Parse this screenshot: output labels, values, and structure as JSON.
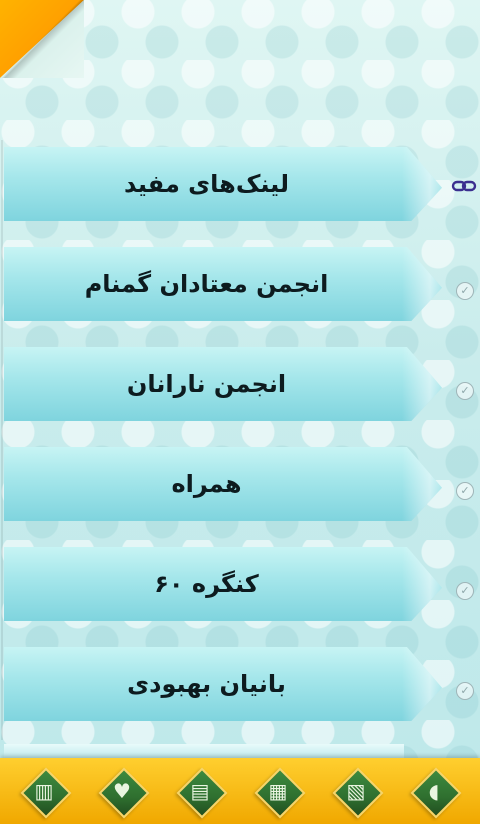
{
  "colors": {
    "accent": "#ff9c00",
    "footer": "#f7b800",
    "band": "#9ee4ea"
  },
  "menu": {
    "items": [
      {
        "label": "لینک‌های مفید",
        "icon": "link-icon"
      },
      {
        "label": "انجمن معتادان گمنام",
        "icon": "check-icon"
      },
      {
        "label": "انجمن نارانان",
        "icon": "check-icon"
      },
      {
        "label": "همراه",
        "icon": "check-icon"
      },
      {
        "label": "کنگره ۶۰",
        "icon": "check-icon"
      },
      {
        "label": "بانیان بهبودی",
        "icon": "check-icon"
      }
    ]
  },
  "footer": {
    "buttons": [
      {
        "icon": "building-icon"
      },
      {
        "icon": "heart-icon"
      },
      {
        "icon": "stripes-icon"
      },
      {
        "icon": "city-icon"
      },
      {
        "icon": "book-icon"
      },
      {
        "icon": "user-icon"
      }
    ]
  }
}
